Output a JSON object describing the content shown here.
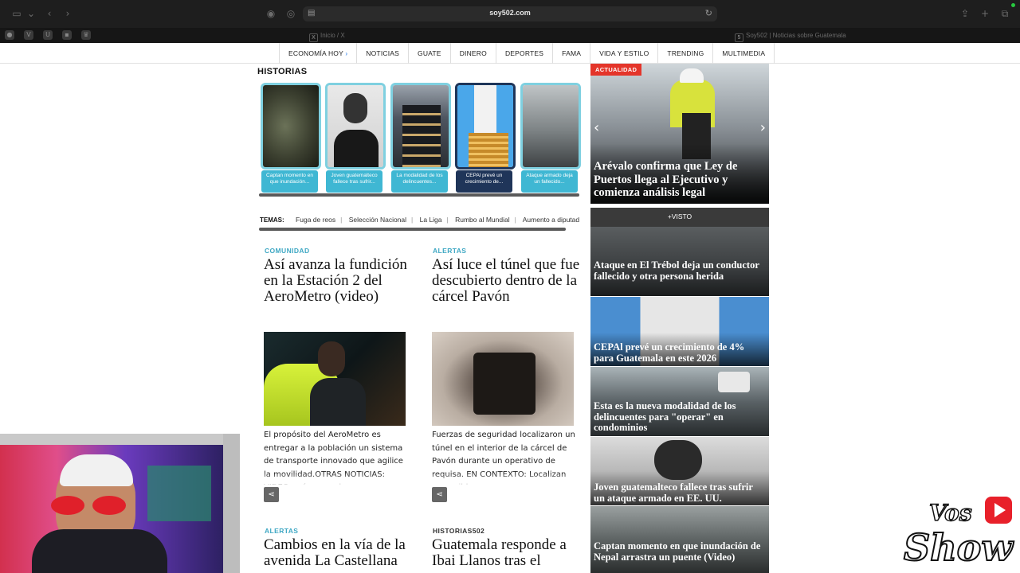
{
  "browser": {
    "url": "soy502.com",
    "tabs": [
      {
        "label": "Inicio / X",
        "icon": "x-logo-icon"
      },
      {
        "label": "Soy502 | Noticias sobre Guatemala",
        "icon": "soy502-icon"
      }
    ]
  },
  "nav": {
    "items": [
      "ECONOMÍA HOY",
      "NOTICIAS",
      "GUATE",
      "DINERO",
      "DEPORTES",
      "FAMA",
      "VIDA Y ESTILO",
      "TRENDING",
      "MULTIMEDIA"
    ],
    "first_chevron": "›"
  },
  "historias": {
    "title": "HISTORIAS",
    "stories": [
      {
        "label": "Captan momento en que inundación..."
      },
      {
        "label": "Joven guatemalteco fallece tras sufrir..."
      },
      {
        "label": "La modalidad de los delincuentes..."
      },
      {
        "label": "CEPAl prevé un crecimiento de..."
      },
      {
        "label": "Ataque armado deja un fallecido..."
      }
    ]
  },
  "temas": {
    "label": "TEMAS:",
    "items": [
      "Fuga de reos",
      "Selección Nacional",
      "La Liga",
      "Rumbo al Mundial",
      "Aumento a diputad"
    ]
  },
  "articles": [
    {
      "category": "COMUNIDAD",
      "title": "Así avanza la fundición en la Estación 2 del AeroMetro (video)",
      "excerpt": "El propósito del AeroMetro es entregar a la población un sistema de transporte innovado que agilice la movilidad.OTRAS NOTICIAS: VIDEO: así avanza la"
    },
    {
      "category": "ALERTAS",
      "title": "Así luce el túnel que fue descubierto dentro de la cárcel Pavón",
      "excerpt": "Fuerzas de seguridad localizaron un túnel en el interior de la cárcel de Pavón durante un operativo de requisa. EN CONTEXTO: Localizan un posible"
    },
    {
      "category": "ALERTAS",
      "title": "Cambios en la vía de la avenida La Castellana"
    },
    {
      "category": "HISTORIAS502",
      "title": "Guatemala responde a Ibai Llanos tras el"
    }
  ],
  "hero": {
    "badge": "ACTUALIDAD",
    "title": "Arévalo confirma que Ley de Puertos llega al Ejecutivo y comienza análisis legal",
    "prev": "‹",
    "next": "›"
  },
  "mas_visto": {
    "title": "+VISTO",
    "items": [
      {
        "title": "Ataque en El Trébol deja un conductor fallecido y otra persona herida"
      },
      {
        "title": "CEPAl prevé un crecimiento de 4% para Guatemala en este 2026"
      },
      {
        "title": "Esta es la nueva modalidad de los delincuentes para \"operar\" en condominios"
      },
      {
        "title": "Joven guatemalteco fallece tras sufrir un ataque armado en EE. UU."
      },
      {
        "title": "Captan momento en que inundación de Nepal arrastra un puente (Video)"
      }
    ]
  },
  "overlay": {
    "logo_line1": "Vos",
    "logo_line2": "Show"
  }
}
